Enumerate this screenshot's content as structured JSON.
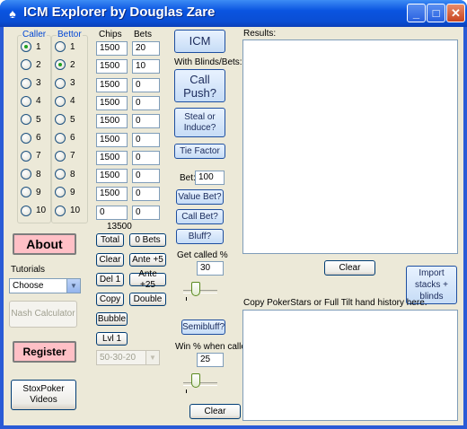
{
  "window": {
    "title": "ICM Explorer by Douglas Zare",
    "app_icon": "spade-icon",
    "minimize_glyph": "_",
    "maximize_glyph": "□",
    "close_glyph": "✕"
  },
  "caller": {
    "label": "Caller",
    "selected": 1,
    "items": [
      "1",
      "2",
      "3",
      "4",
      "5",
      "6",
      "7",
      "8",
      "9",
      "10"
    ]
  },
  "bettor": {
    "label": "Bettor",
    "selected": 2,
    "items": [
      "1",
      "2",
      "3",
      "4",
      "5",
      "6",
      "7",
      "8",
      "9",
      "10"
    ]
  },
  "stacks": {
    "chips_header": "Chips",
    "bets_header": "Bets",
    "rows": [
      {
        "chips": "1500",
        "bet": "20"
      },
      {
        "chips": "1500",
        "bet": "10"
      },
      {
        "chips": "1500",
        "bet": "0"
      },
      {
        "chips": "1500",
        "bet": "0"
      },
      {
        "chips": "1500",
        "bet": "0"
      },
      {
        "chips": "1500",
        "bet": "0"
      },
      {
        "chips": "1500",
        "bet": "0"
      },
      {
        "chips": "1500",
        "bet": "0"
      },
      {
        "chips": "1500",
        "bet": "0"
      },
      {
        "chips": "0",
        "bet": "0"
      }
    ],
    "total_chips": "13500"
  },
  "buttons": {
    "total": "Total",
    "zero_bets": "0 Bets",
    "clear": "Clear",
    "ante_5": "Ante +5",
    "del1": "Del 1",
    "ante_25": "Ante +25",
    "copy": "Copy",
    "double": "Double",
    "bubble": "Bubble",
    "lvl1": "Lvl 1",
    "about": "About",
    "nash": "Nash Calculator",
    "register": "Register",
    "stoxpoker": "StoxPoker Videos",
    "icm": "ICM",
    "call_push": "Call Push?",
    "steal_induce": "Steal or Induce?",
    "tie_factor": "Tie Factor",
    "value_bet": "Value Bet?",
    "call_bet": "Call Bet?",
    "bluff": "Bluff?",
    "semibluff": "Semibluff?",
    "clear_bottom": "Clear",
    "clear_results": "Clear",
    "import": "Import stacks + blinds"
  },
  "payout_select": {
    "value": "50-30-20"
  },
  "tutorials": {
    "label": "Tutorials",
    "value": "Choose"
  },
  "labels": {
    "with_blinds": "With Blinds/Bets:",
    "bet": "Bet:",
    "get_called": "Get called %",
    "win_when_called": "Win % when called",
    "results": "Results:",
    "copy_history": "Copy PokerStars or Full Tilt hand history here."
  },
  "inputs": {
    "bet_amount": "100",
    "get_called_pct": "30",
    "win_pct": "25"
  }
}
